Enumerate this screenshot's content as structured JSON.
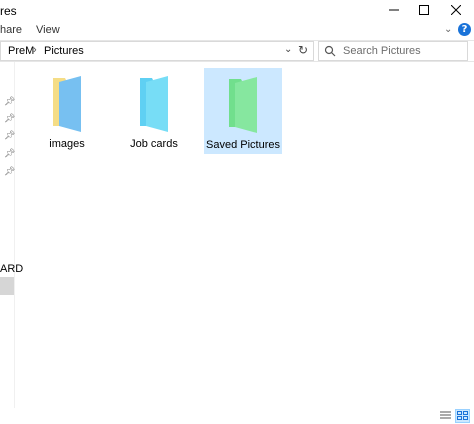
{
  "window": {
    "title_fragment": "res"
  },
  "ribbon": {
    "tabs": [
      {
        "label": "hare"
      },
      {
        "label": "View"
      }
    ]
  },
  "address": {
    "crumbs": [
      {
        "label": "PreM"
      },
      {
        "label": "Pictures"
      }
    ]
  },
  "search": {
    "placeholder": "Search Pictures"
  },
  "nav_pane": {
    "label_fragment": "ARD"
  },
  "folders": [
    {
      "label": "images",
      "color_front": "#77c0f1",
      "color_back": "#f5dd86"
    },
    {
      "label": "Job cards",
      "color_front": "#77ddf6",
      "color_back": "#5fd0f3"
    },
    {
      "label": "Saved Pictures",
      "color_front": "#86e79f",
      "color_back": "#71df8d",
      "selected": true
    }
  ],
  "colors": {
    "selection": "#cce8ff",
    "help": "#1a73d9"
  }
}
